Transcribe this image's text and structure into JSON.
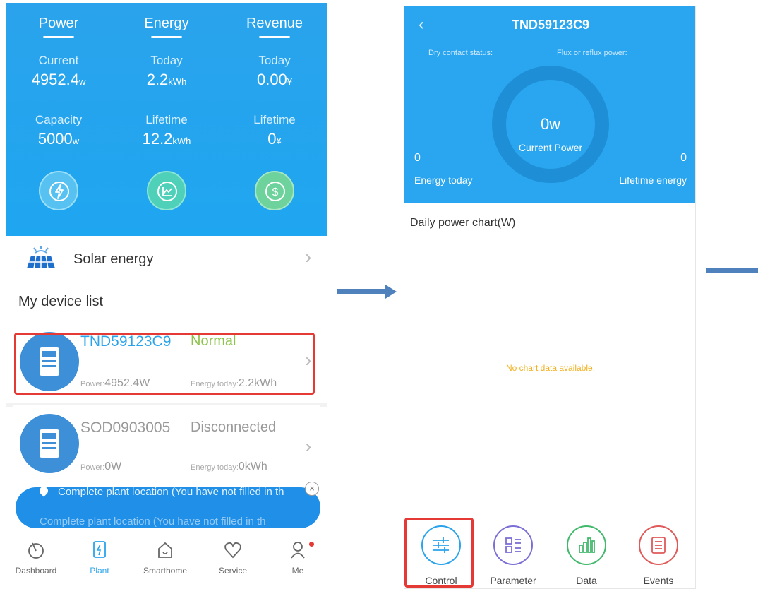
{
  "left": {
    "tabs": [
      "Power",
      "Energy",
      "Revenue"
    ],
    "stats_row1": [
      {
        "label": "Current",
        "value": "4952.4",
        "unit": "w"
      },
      {
        "label": "Today",
        "value": "2.2",
        "unit": "kWh"
      },
      {
        "label": "Today",
        "value": "0.00",
        "unit": "¥"
      }
    ],
    "stats_row2": [
      {
        "label": "Capacity",
        "value": "5000",
        "unit": "w"
      },
      {
        "label": "Lifetime",
        "value": "12.2",
        "unit": "kWh"
      },
      {
        "label": "Lifetime",
        "value": "0",
        "unit": "¥"
      }
    ],
    "icons": [
      "lightning-icon",
      "chart-icon",
      "dollar-icon"
    ],
    "solar_row": {
      "label": "Solar energy",
      "icon": "solar-panel-icon"
    },
    "device_list_title": "My device list",
    "devices": [
      {
        "name": "TND59123C9",
        "status": "Normal",
        "status_color": "#8bc34a",
        "name_color": "#2aa3ec",
        "power_label": "Power:",
        "power_value": "4952.4W",
        "energy_label": "Energy today:",
        "energy_value": "2.2kWh"
      },
      {
        "name": "SOD0903005",
        "status": "Disconnected",
        "status_color": "#999999",
        "name_color": "#999999",
        "power_label": "Power:",
        "power_value": "0W",
        "energy_label": "Energy today:",
        "energy_value": "0kWh"
      }
    ],
    "banner": {
      "line1": "Complete plant location  (You have not filled in th",
      "line2": "Complete plant location (You have not filled in th"
    },
    "nav": [
      {
        "label": "Dashboard",
        "icon": "dashboard-icon"
      },
      {
        "label": "Plant",
        "icon": "plant-icon"
      },
      {
        "label": "Smarthome",
        "icon": "home-icon"
      },
      {
        "label": "Service",
        "icon": "heart-icon"
      },
      {
        "label": "Me",
        "icon": "user-icon"
      }
    ],
    "accent": "#2aa3ec"
  },
  "right": {
    "title": "TND59123C9",
    "dry_contact_label": "Dry contact status:",
    "flux_label": "Flux or reflux power:",
    "current_power_value": "0w",
    "current_power_label": "Current Power",
    "energy_today_value": "0",
    "energy_today_label": "Energy today",
    "lifetime_value": "0",
    "lifetime_label": "Lifetime energy",
    "chart_title": "Daily power chart(W)",
    "no_data": "No chart data available.",
    "tabs": [
      {
        "label": "Control",
        "icon": "sliders-icon",
        "color": "#2aa3ec"
      },
      {
        "label": "Parameter",
        "icon": "grid-list-icon",
        "color": "#7b6fd6"
      },
      {
        "label": "Data",
        "icon": "bar-chart-icon",
        "color": "#43b96d"
      },
      {
        "label": "Events",
        "icon": "list-icon",
        "color": "#e05a5a"
      }
    ]
  }
}
